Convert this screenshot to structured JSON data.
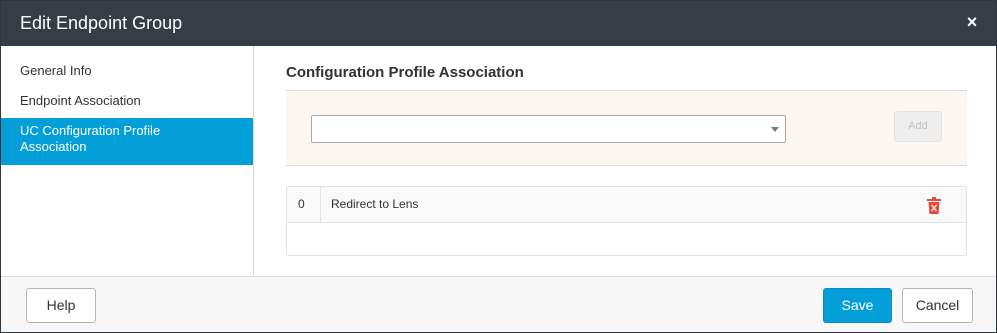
{
  "dialog": {
    "title": "Edit Endpoint Group",
    "close_glyph": "×"
  },
  "sidebar": {
    "items": [
      {
        "label": "General Info",
        "active": false
      },
      {
        "label": "Endpoint Association",
        "active": false
      },
      {
        "label": "UC Configuration Profile Association",
        "active": true
      }
    ]
  },
  "main": {
    "section_title": "Configuration Profile Association",
    "profile_select": {
      "value": ""
    },
    "add_label": "Add",
    "rows": [
      {
        "index": "0",
        "name": "Redirect to Lens"
      }
    ]
  },
  "footer": {
    "help_label": "Help",
    "save_label": "Save",
    "cancel_label": "Cancel"
  },
  "colors": {
    "titlebar": "#363d44",
    "accent": "#049fd9",
    "delete_icon": "#e8483a",
    "association_panel": "#fdf5ef"
  },
  "icons": {
    "close": "close-icon",
    "dropdown": "chevron-down-icon",
    "delete": "trash-icon"
  }
}
